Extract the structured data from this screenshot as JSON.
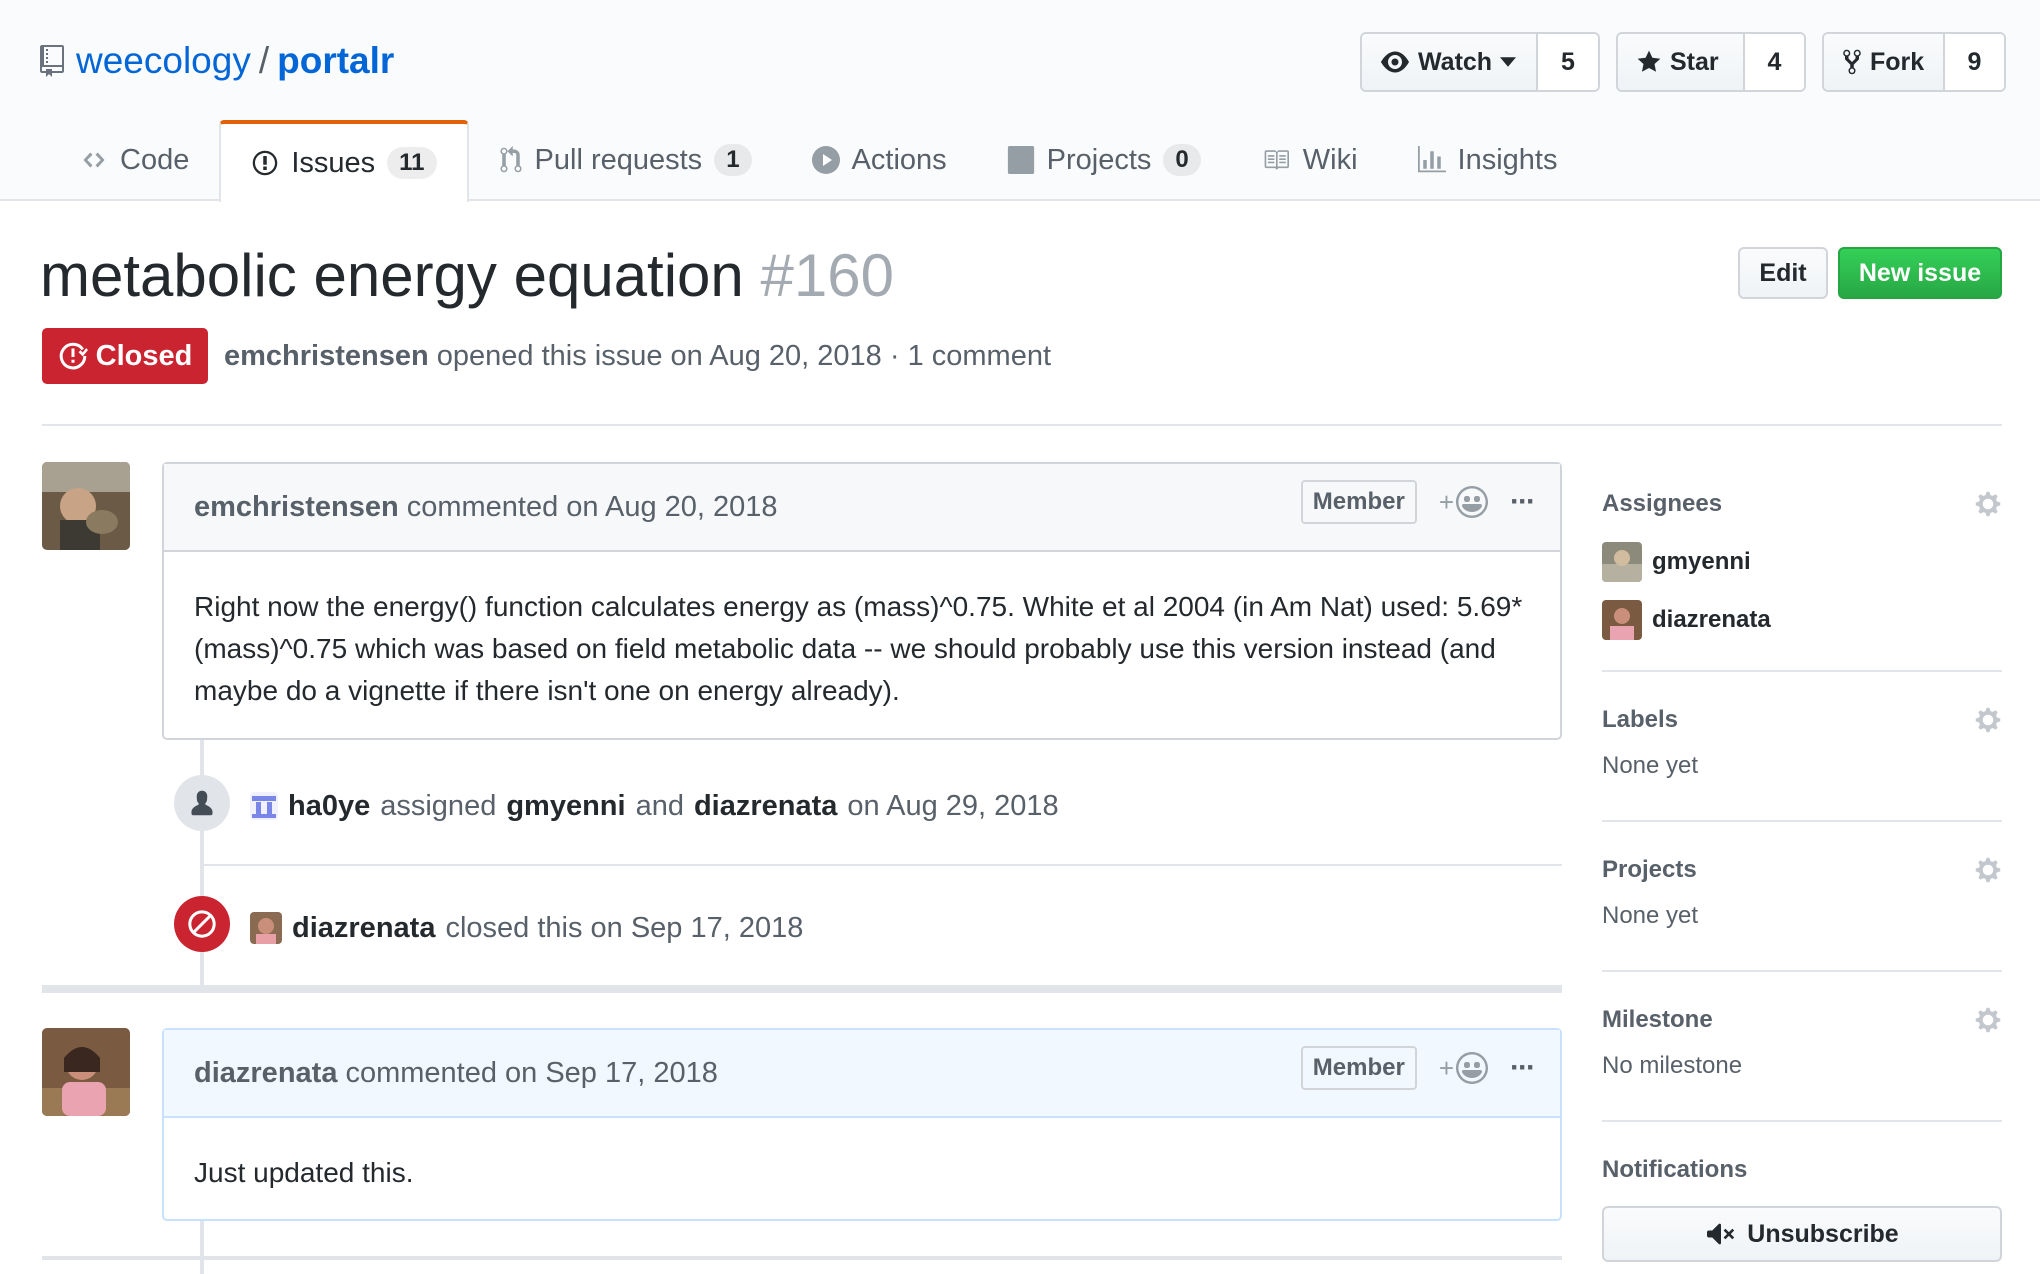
{
  "repo": {
    "owner": "weecology",
    "separator": "/",
    "name": "portalr"
  },
  "actions": {
    "watch": {
      "label": "Watch",
      "count": "5"
    },
    "star": {
      "label": "Star",
      "count": "4"
    },
    "fork": {
      "label": "Fork",
      "count": "9"
    }
  },
  "tabs": [
    {
      "label": "Code",
      "icon": "code-icon"
    },
    {
      "label": "Issues",
      "count": "11",
      "icon": "issue-opened-icon"
    },
    {
      "label": "Pull requests",
      "count": "1",
      "icon": "git-pull-request-icon"
    },
    {
      "label": "Actions",
      "icon": "play-icon"
    },
    {
      "label": "Projects",
      "count": "0",
      "icon": "project-icon"
    },
    {
      "label": "Wiki",
      "icon": "book-icon"
    },
    {
      "label": "Insights",
      "icon": "graph-icon"
    }
  ],
  "issue": {
    "title": "metabolic energy equation",
    "number": "#160",
    "state": "Closed",
    "author": "emchristensen",
    "opened_text": "opened this issue on Aug 20, 2018 · 1 comment",
    "edit_label": "Edit",
    "new_issue_label": "New issue"
  },
  "comments": [
    {
      "author": "emchristensen",
      "meta": "commented on Aug 20, 2018",
      "role": "Member",
      "body": "Right now the energy() function calculates energy as (mass)^0.75. White et al 2004 (in Am Nat) used: 5.69*(mass)^0.75 which was based on field metabolic data -- we should probably use this version instead (and maybe do a vignette if there isn't one on energy already)."
    },
    {
      "author": "diazrenata",
      "meta": "commented on Sep 17, 2018",
      "role": "Member",
      "body": "Just updated this."
    }
  ],
  "events": {
    "assigned": {
      "actor": "ha0ye",
      "verb": "assigned",
      "user1": "gmyenni",
      "conj": "and",
      "user2": "diazrenata",
      "date": "on Aug 29, 2018"
    },
    "closed": {
      "actor": "diazrenata",
      "text": "closed this on Sep 17, 2018"
    }
  },
  "comment_actions": {
    "reaction": "+",
    "more": "···"
  },
  "sidebar": {
    "assignees_heading": "Assignees",
    "assignees": [
      "gmyenni",
      "diazrenata"
    ],
    "labels_heading": "Labels",
    "labels_value": "None yet",
    "projects_heading": "Projects",
    "projects_value": "None yet",
    "milestone_heading": "Milestone",
    "milestone_value": "No milestone",
    "notifications_heading": "Notifications",
    "unsubscribe_label": "Unsubscribe"
  },
  "colors": {
    "link": "#0366d6",
    "closed": "#cb2431",
    "green": "#28a745",
    "tab_accent": "#e36209"
  }
}
